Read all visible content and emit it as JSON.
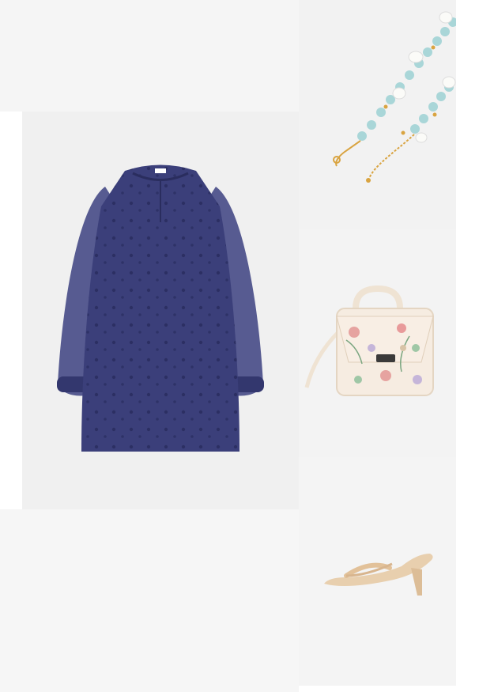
{
  "outfit": {
    "items": [
      {
        "id": "dress",
        "icon": "dress-icon",
        "color": "#3b3f7a"
      },
      {
        "id": "bracelet",
        "icon": "bracelet-icon",
        "color": "#a9d6d8"
      },
      {
        "id": "handbag",
        "icon": "handbag-icon",
        "color": "#f3e6d8"
      },
      {
        "id": "sandals",
        "icon": "sandal-icon",
        "color": "#e4c5a0"
      }
    ]
  }
}
